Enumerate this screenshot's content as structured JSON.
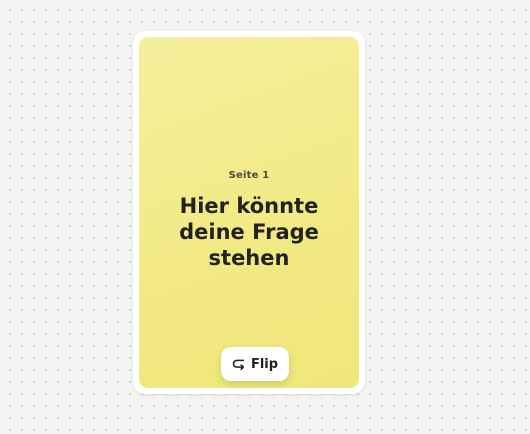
{
  "card": {
    "page_label": "Seite 1",
    "question": "Hier könnte deine Frage stehen",
    "flip_button": {
      "label": "Flip",
      "icon": "rotate-icon"
    }
  },
  "colors": {
    "card_face": "#f1ea85",
    "card_frame": "#ffffff",
    "text": "#22231f",
    "canvas": "#f4f4f2"
  }
}
